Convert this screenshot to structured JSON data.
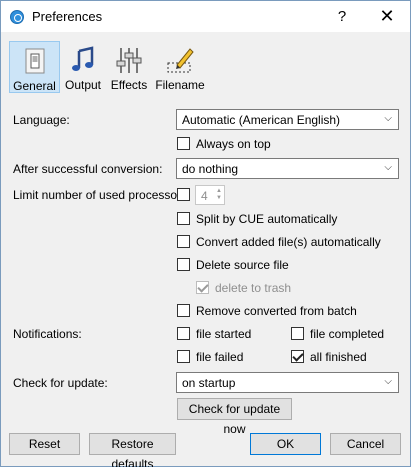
{
  "window": {
    "title": "Preferences",
    "help": "?",
    "close": "✕"
  },
  "toolbar": {
    "general": "General",
    "output": "Output",
    "effects": "Effects",
    "filename": "Filename"
  },
  "language": {
    "label": "Language:",
    "value": "Automatic (American English)"
  },
  "always_on_top": {
    "label": "Always on top",
    "checked": false
  },
  "after_conversion": {
    "label": "After successful conversion:",
    "value": "do nothing"
  },
  "processors": {
    "label": "Limit number of used processors:",
    "checked": false,
    "value": "4"
  },
  "split_cue": {
    "label": "Split by CUE automatically",
    "checked": false
  },
  "convert_added": {
    "label": "Convert added file(s) automatically",
    "checked": false
  },
  "delete_source": {
    "label": "Delete source file",
    "checked": false
  },
  "delete_to_trash": {
    "label": "delete to trash",
    "checked": true
  },
  "remove_converted": {
    "label": "Remove converted from batch",
    "checked": false
  },
  "notifications": {
    "label": "Notifications:",
    "file_started": "file started",
    "file_completed": "file completed",
    "file_failed": "file failed",
    "all_finished": "all finished"
  },
  "update": {
    "label": "Check for update:",
    "value": "on startup",
    "check_now": "Check for update now"
  },
  "buttons": {
    "reset": "Reset",
    "restore": "Restore defaults",
    "ok": "OK",
    "cancel": "Cancel"
  }
}
